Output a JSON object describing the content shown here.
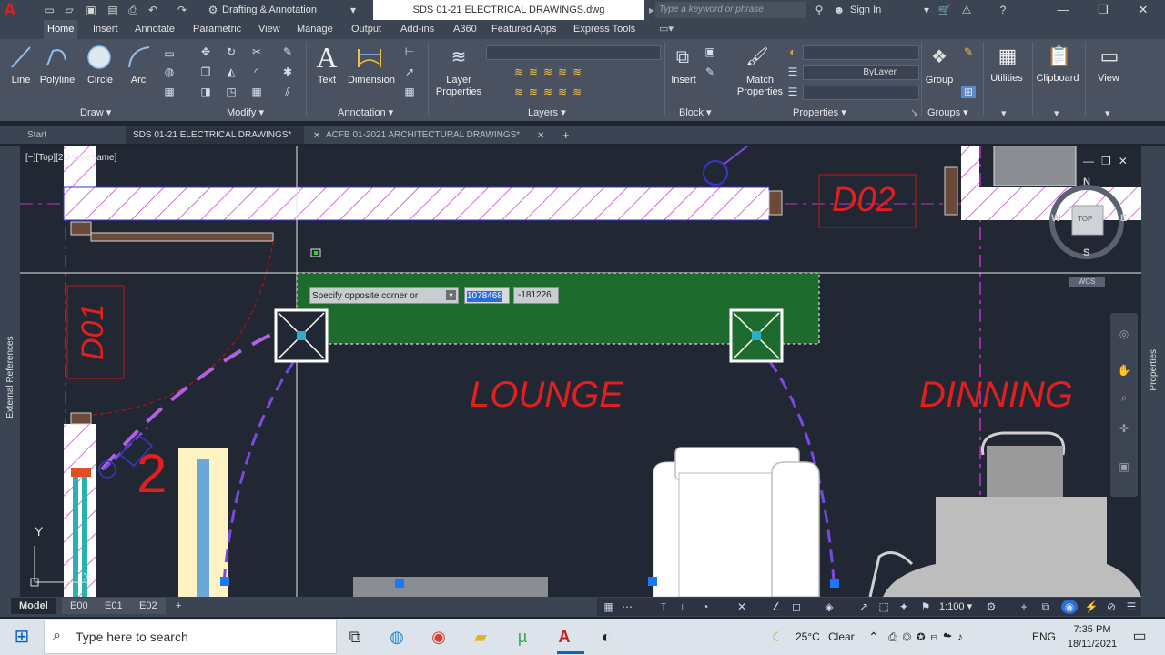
{
  "titlebar": {
    "app_logo": "A",
    "workspace": "Drafting & Annotation",
    "document_title": "SDS 01-21 ELECTRICAL DRAWINGS.dwg",
    "search_placeholder": "Type a keyword or phrase",
    "sign_in": "Sign In"
  },
  "ribbon_tabs": [
    "Home",
    "Insert",
    "Annotate",
    "Parametric",
    "View",
    "Manage",
    "Output",
    "Add-ins",
    "A360",
    "Featured Apps",
    "Express Tools"
  ],
  "ribbon": {
    "draw_tools": [
      "Line",
      "Polyline",
      "Circle",
      "Arc"
    ],
    "text_label": "Text",
    "dimension_label": "Dimension",
    "layer_properties_label": "Layer\nProperties",
    "insert_label": "Insert",
    "match_properties_label": "Match\nProperties",
    "bylayer_label": "ByLayer",
    "group_label": "Group",
    "utilities_label": "Utilities",
    "clipboard_label": "Clipboard",
    "view_label": "View",
    "panels": [
      "Draw",
      "Modify",
      "Annotation",
      "Layers",
      "Block",
      "Properties",
      "Groups"
    ]
  },
  "file_tabs": [
    "Start",
    "SDS 01-21 ELECTRICAL DRAWINGS*",
    "ACFB 01-2021 ARCHITECTURAL DRAWINGS*"
  ],
  "viewport": {
    "view_label": "[−][Top][2D Wireframe]",
    "prompt": "Specify opposite corner or",
    "coord_x": "1078468",
    "coord_y": "-181226",
    "viewcube": {
      "n": "N",
      "s": "S",
      "w": "W",
      "e": "E",
      "top": "TOP",
      "wcs": "WCS"
    },
    "ucs_y": "Y"
  },
  "drawing": {
    "door_tags": [
      "D01",
      "D02"
    ],
    "room_names": [
      "LOUNGE",
      "DINNING"
    ],
    "label_number": "2"
  },
  "side_palettes": {
    "left": "External References",
    "right": "Properties"
  },
  "layout_tabs": [
    "Model",
    "E00",
    "E01",
    "E02"
  ],
  "status": {
    "scale": "1:100"
  },
  "taskbar": {
    "search_placeholder": "Type here to search",
    "weather_temp": "25°C",
    "weather_text": "Clear",
    "language": "ENG",
    "time": "7:35 PM",
    "date": "18/11/2021"
  },
  "colors": {
    "accent_red": "#e02020",
    "selection_green": "#1e6b2e",
    "hatch_magenta": "#c42fd0",
    "arc_purple": "#7a4ae0"
  }
}
